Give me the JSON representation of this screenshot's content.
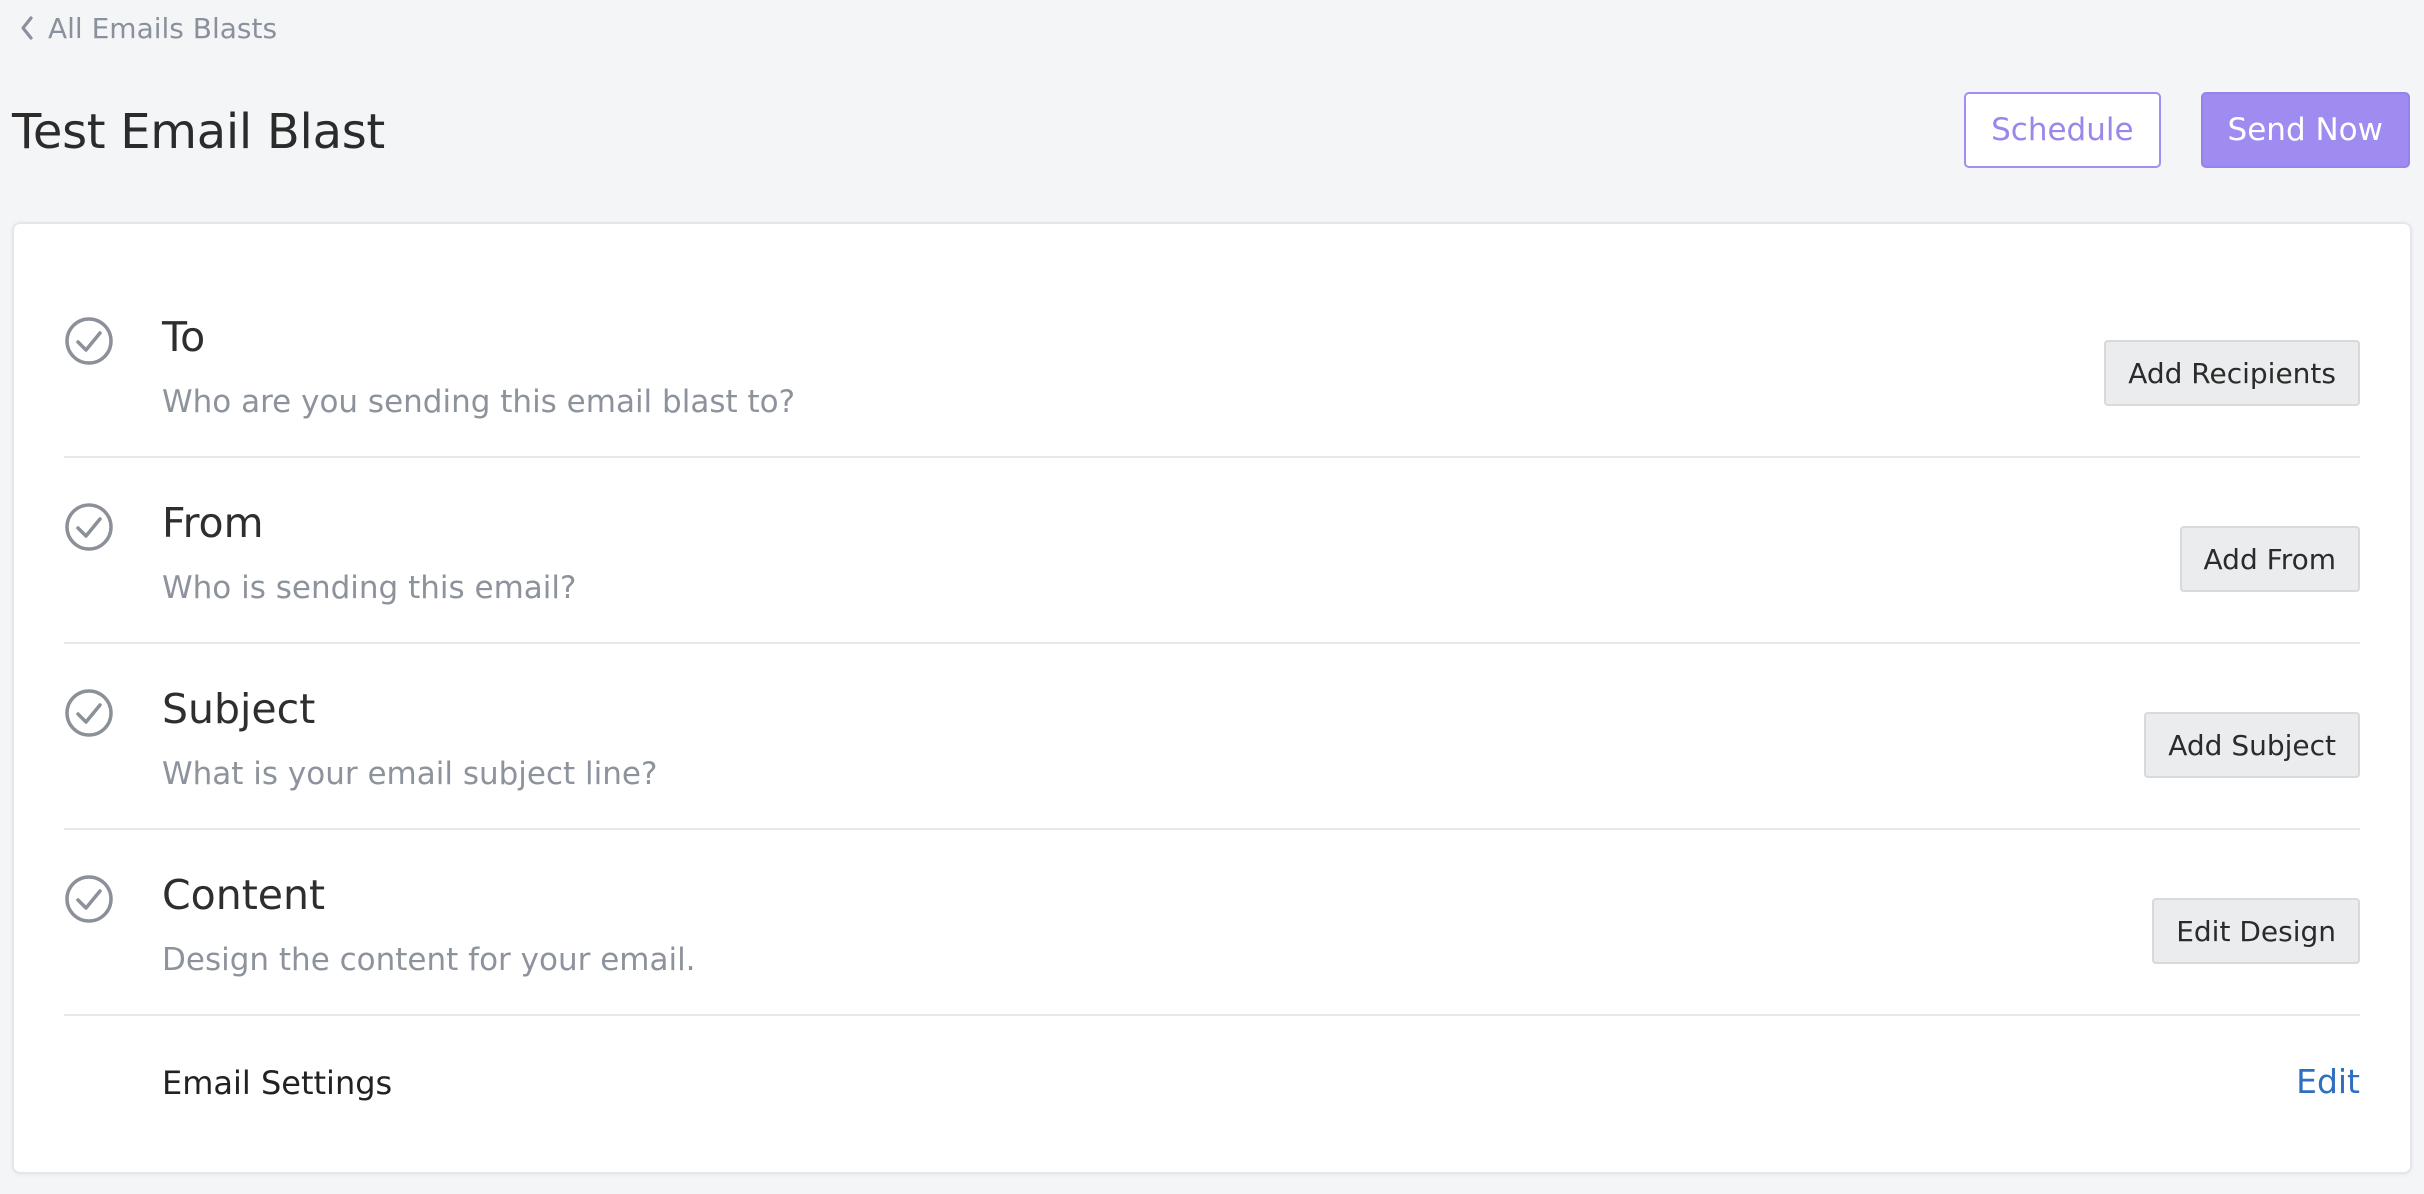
{
  "nav": {
    "back_label": "All Emails Blasts"
  },
  "header": {
    "title": "Test Email Blast",
    "schedule_label": "Schedule",
    "send_now_label": "Send Now"
  },
  "steps": [
    {
      "title": "To",
      "description": "Who are you sending this email blast to?",
      "action_label": "Add Recipients"
    },
    {
      "title": "From",
      "description": "Who is sending this email?",
      "action_label": "Add From"
    },
    {
      "title": "Subject",
      "description": "What is your email subject line?",
      "action_label": "Add Subject"
    },
    {
      "title": "Content",
      "description": "Design the content for your email.",
      "action_label": "Edit Design"
    }
  ],
  "settings": {
    "label": "Email Settings",
    "edit_label": "Edit"
  },
  "colors": {
    "accent": "#a08bf0",
    "link": "#2f6fbf",
    "muted_text": "#8d939c",
    "page_bg": "#f4f5f7"
  },
  "icons": {
    "back": "chevron-left-icon",
    "step_status": "check-circle-icon"
  }
}
